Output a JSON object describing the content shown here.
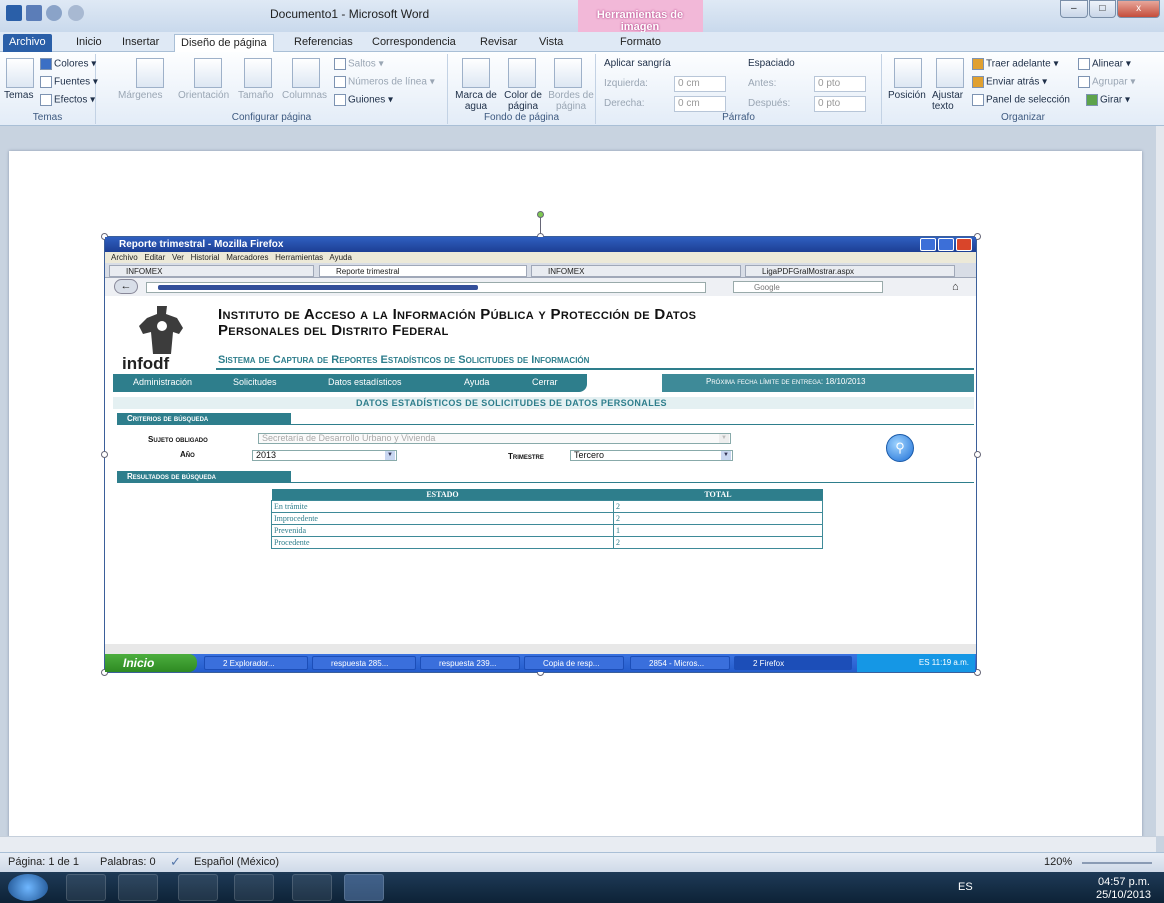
{
  "window": {
    "title": "Documento1  -  Microsoft Word",
    "context_tab_group": "Herramientas de imagen",
    "controls": [
      "–",
      "□",
      "x"
    ]
  },
  "ribbon_tabs": [
    "Archivo",
    "Inicio",
    "Insertar",
    "Diseño de página",
    "Referencias",
    "Correspondencia",
    "Revisar",
    "Vista",
    "Formato"
  ],
  "ribbon": {
    "temas": {
      "label": "Temas",
      "big": "Temas",
      "colores": "Colores",
      "fuentes": "Fuentes",
      "efectos": "Efectos"
    },
    "configurar": {
      "label": "Configurar página",
      "margenes": "Márgenes",
      "orientacion": "Orientación",
      "tamano": "Tamaño",
      "columnas": "Columnas",
      "saltos": "Saltos",
      "numeros": "Números de línea",
      "guiones": "Guiones"
    },
    "fondo": {
      "label": "Fondo de página",
      "marca": "Marca de agua",
      "color": "Color de página",
      "bordes": "Bordes de página"
    },
    "parrafo": {
      "label": "Párrafo",
      "sangria": "Aplicar sangría",
      "izquierda": "Izquierda:",
      "izq_val": "0 cm",
      "derecha": "Derecha:",
      "der_val": "0 cm",
      "espaciado": "Espaciado",
      "antes": "Antes:",
      "antes_val": "0 pto",
      "despues": "Después:",
      "despues_val": "0 pto"
    },
    "organizar": {
      "label": "Organizar",
      "posicion": "Posición",
      "ajustar": "Ajustar texto",
      "traer": "Traer adelante",
      "enviar": "Enviar atrás",
      "panel": "Panel de selección",
      "alinear": "Alinear",
      "agrupar": "Agrupar",
      "girar": "Girar"
    }
  },
  "embedded": {
    "ff_title": "Reporte trimestral - Mozilla Firefox",
    "ff_menu": [
      "Archivo",
      "Editar",
      "Ver",
      "Historial",
      "Marcadores",
      "Herramientas",
      "Ayuda"
    ],
    "ff_tabs": [
      "INFOMEX",
      "Reporte trimestral",
      "INFOMEX",
      "LigaPDFGralMostrar.aspx"
    ],
    "ff_search": "Google",
    "inst_line1": "Instituto de Acceso a la Información Pública y Protección de Datos",
    "inst_line2": "Personales del Distrito Federal",
    "logo_text": "infodf",
    "system_title": "Sistema de Captura de Reportes Estadísticos de Solicitudes de Información",
    "nav": [
      "Administración",
      "Solicitudes",
      "Datos estadísticos",
      "Ayuda",
      "Cerrar"
    ],
    "deadline": "Próxima fecha límite de entrega: 18/10/2013",
    "page_heading": "DATOS ESTADÍSTICOS DE SOLICITUDES DE DATOS PERSONALES",
    "criterios": "Criterios de búsqueda",
    "sujeto_label": "Sujeto obligado",
    "sujeto_value": "Secretaría de Desarrollo Urbano y Vivienda",
    "anio_label": "Año",
    "anio_value": "2013",
    "trimestre_label": "Trimestre",
    "trimestre_value": "Tercero",
    "resultados": "Resultados de búsqueda",
    "table": {
      "headers": [
        "ESTADO",
        "TOTAL"
      ],
      "rows": [
        [
          "En trámite",
          "2"
        ],
        [
          "Improcedente",
          "2"
        ],
        [
          "Prevenida",
          "1"
        ],
        [
          "Procedente",
          "2"
        ]
      ]
    },
    "xp_start": "Inicio",
    "xp_tasks": [
      "2 Explorador...",
      "respuesta 285...",
      "respuesta 239...",
      "Copia de resp...",
      "2854 - Micros...",
      "2 Firefox"
    ],
    "xp_tray": "ES   11:19 a.m."
  },
  "status": {
    "page": "Página: 1 de 1",
    "words": "Palabras: 0",
    "lang": "Español (México)",
    "zoom": "120%"
  },
  "taskbar": {
    "lang": "ES",
    "time": "04:57 p.m.",
    "date": "25/10/2013"
  },
  "colors": {
    "accent": "#2e7e8c",
    "word_blue": "#2a5fa8"
  }
}
